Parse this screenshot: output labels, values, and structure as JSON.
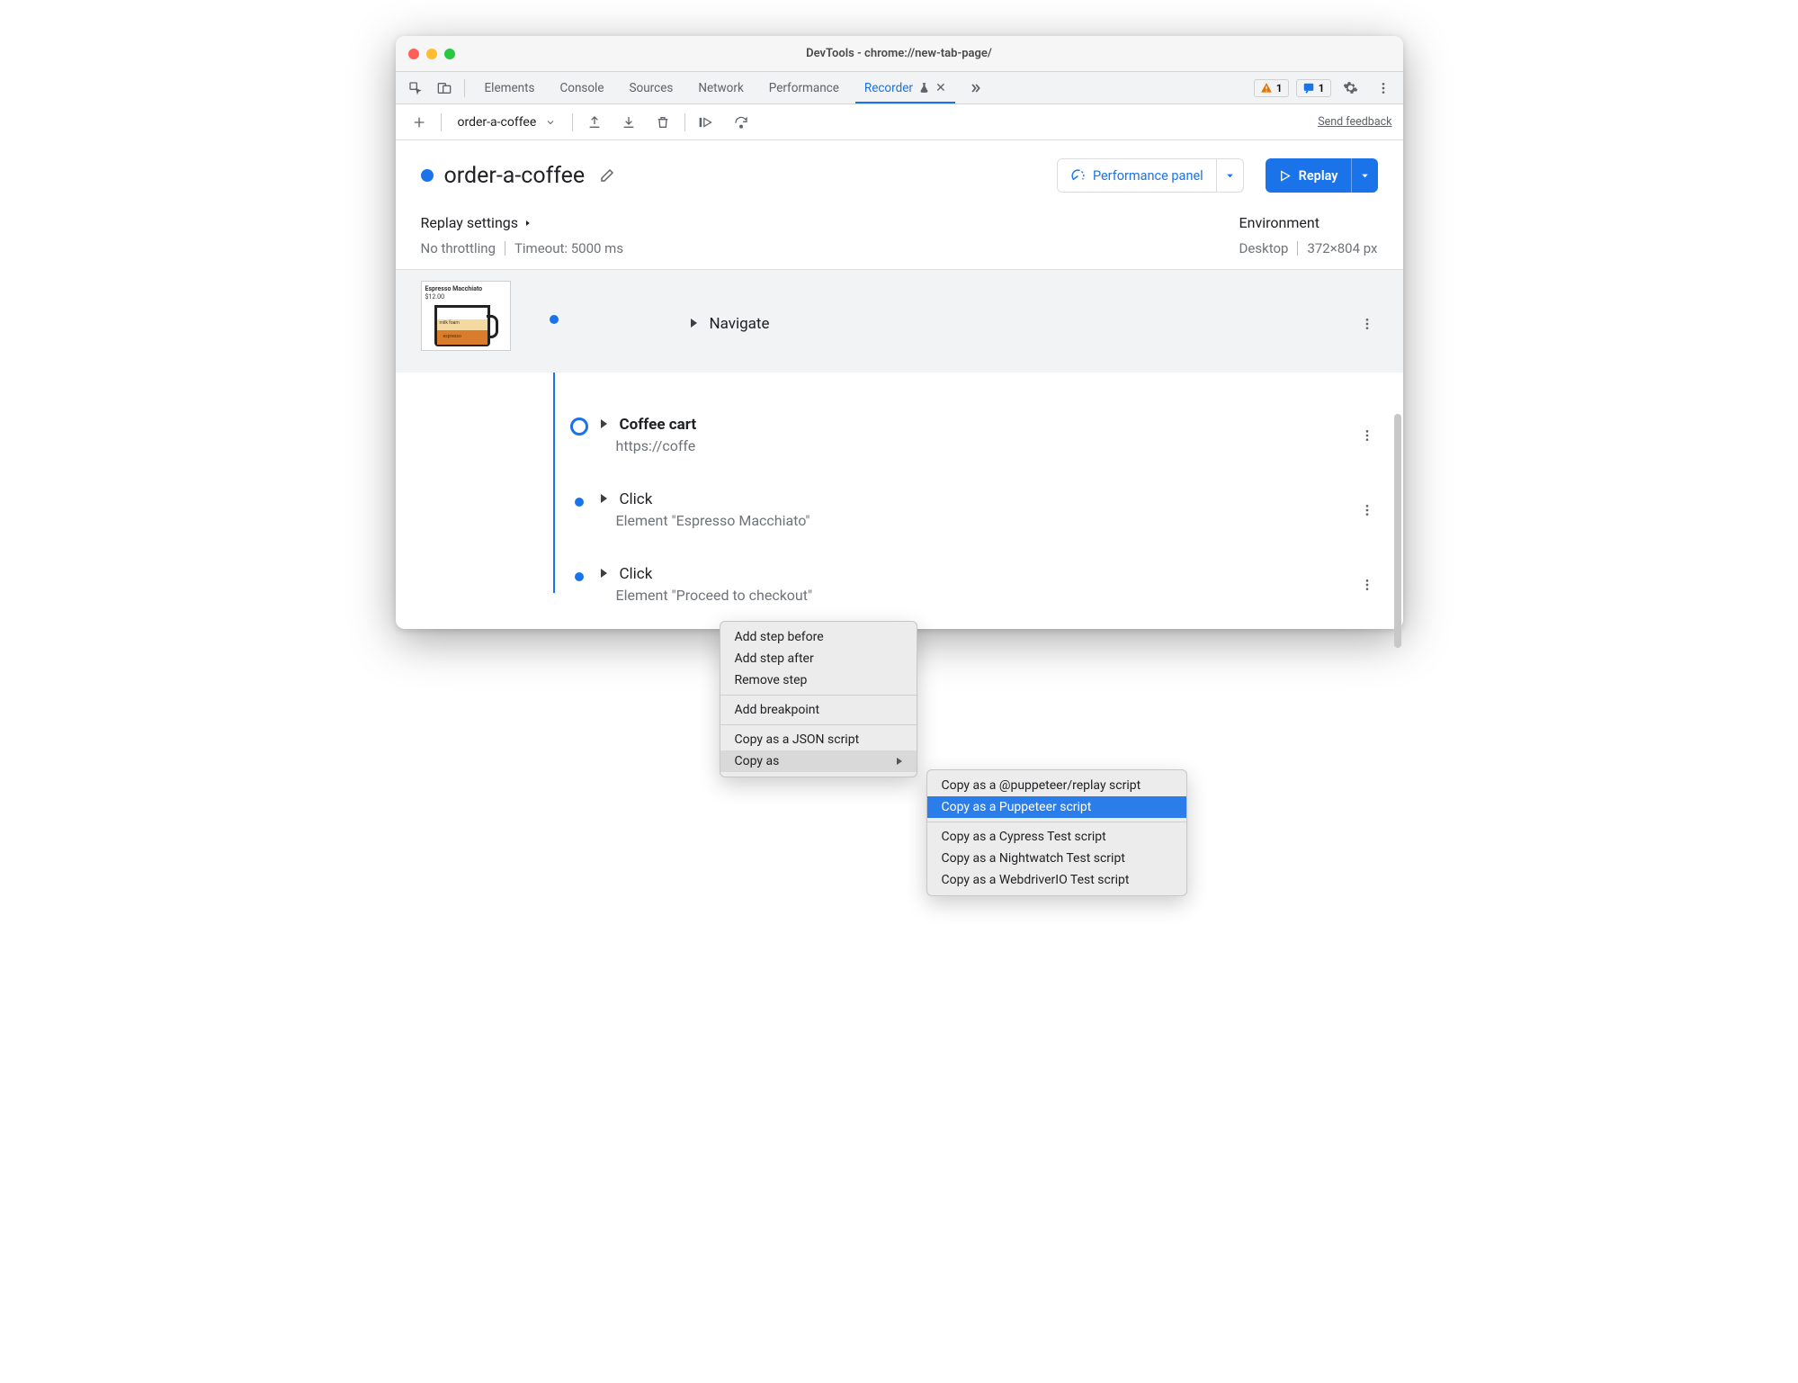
{
  "window": {
    "title": "DevTools - chrome://new-tab-page/"
  },
  "tabs": {
    "items": [
      "Elements",
      "Console",
      "Sources",
      "Network",
      "Performance",
      "Recorder"
    ],
    "active": "Recorder",
    "warn_count": "1",
    "info_count": "1"
  },
  "toolbar": {
    "selected_recording": "order-a-coffee",
    "feedback": "Send feedback"
  },
  "recording": {
    "title": "order-a-coffee",
    "perf_button": "Performance panel",
    "replay_button": "Replay"
  },
  "settings": {
    "replay_heading": "Replay settings",
    "throttling": "No throttling",
    "timeout": "Timeout: 5000 ms",
    "env_heading": "Environment",
    "env_device": "Desktop",
    "env_dims": "372×804 px"
  },
  "thumb": {
    "title": "Espresso Macchiato",
    "price": "$12.00",
    "layer1": "milk foam",
    "layer2": "espresso"
  },
  "steps": [
    {
      "title": "Navigate",
      "sub": ""
    },
    {
      "title": "Coffee cart",
      "sub": "https://coffe"
    },
    {
      "title": "Click",
      "sub": "Element \"Espresso Macchiato\""
    },
    {
      "title": "Click",
      "sub": "Element \"Proceed to checkout\""
    }
  ],
  "menu1": {
    "add_before": "Add step before",
    "add_after": "Add step after",
    "remove": "Remove step",
    "breakpoint": "Add breakpoint",
    "copy_json": "Copy as a JSON script",
    "copy_as": "Copy as"
  },
  "menu2": {
    "replay": "Copy as a @puppeteer/replay script",
    "puppeteer": "Copy as a Puppeteer script",
    "cypress": "Copy as a Cypress Test script",
    "nightwatch": "Copy as a Nightwatch Test script",
    "webdriverio": "Copy as a WebdriverIO Test script"
  }
}
